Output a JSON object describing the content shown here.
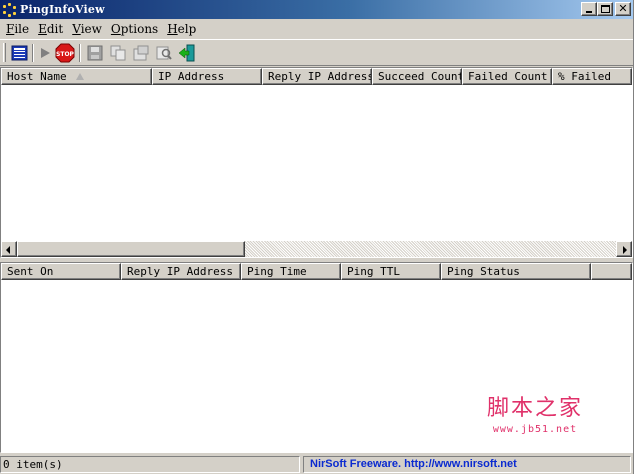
{
  "window": {
    "title": "PingInfoView"
  },
  "menu": [
    {
      "label": "File",
      "key": "F",
      "rest": "ile"
    },
    {
      "label": "Edit",
      "key": "E",
      "rest": "dit"
    },
    {
      "label": "View",
      "key": "V",
      "rest": "iew"
    },
    {
      "label": "Options",
      "key": "O",
      "rest": "ptions"
    },
    {
      "label": "Help",
      "key": "H",
      "rest": "elp"
    }
  ],
  "toolbar": {
    "icons": [
      "options-list-icon",
      "play-icon",
      "stop-icon",
      "save-icon",
      "copy-icon",
      "html-report-icon",
      "find-icon",
      "exit-icon"
    ],
    "stop_label": "STOP"
  },
  "top_table": {
    "columns": [
      "Host Name",
      "IP Address",
      "Reply IP Address",
      "Succeed Count",
      "Failed Count",
      "% Failed"
    ],
    "sort_column": "Host Name",
    "rows": []
  },
  "bottom_table": {
    "columns": [
      "Sent On",
      "Reply IP Address",
      "Ping Time",
      "Ping TTL",
      "Ping Status"
    ],
    "rows": []
  },
  "statusbar": {
    "count": "0 item(s)",
    "credit": "NirSoft Freeware.  http://www.nirsoft.net"
  },
  "watermark": {
    "text": "脚本之家",
    "url": "www.jb51.net"
  },
  "colors": {
    "titlebar_start": "#0a246a",
    "titlebar_end": "#a6caf0",
    "face": "#d4d0c8",
    "link": "#0a2ad0",
    "watermark": "#e0316a"
  }
}
